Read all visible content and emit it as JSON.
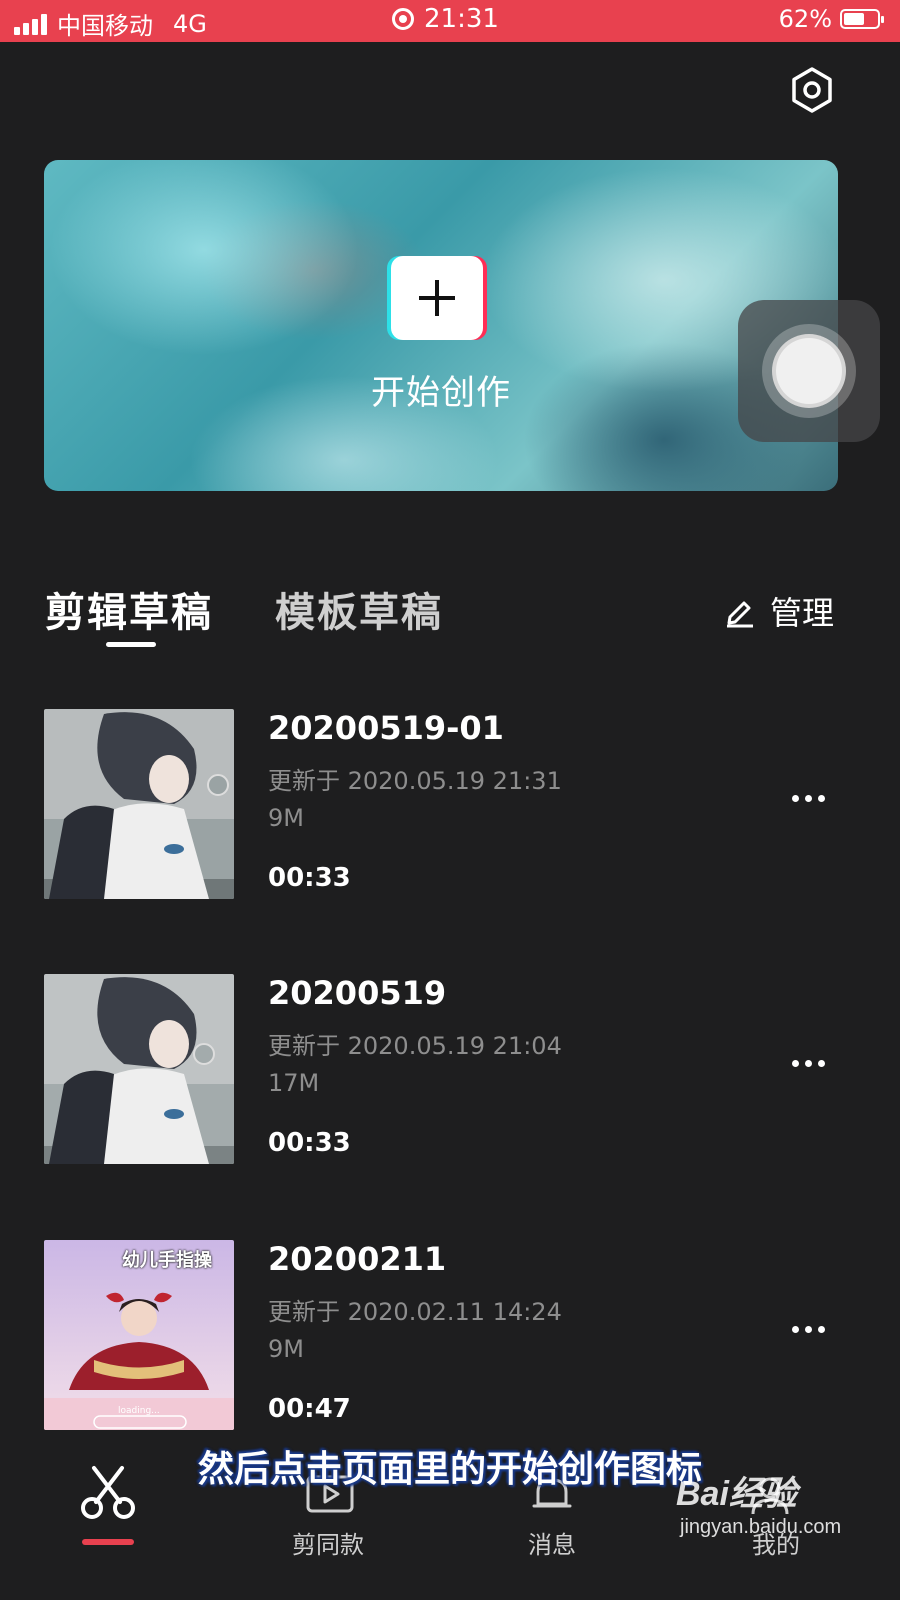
{
  "status_bar": {
    "carrier": "中国移动",
    "network": "4G",
    "time": "21:31",
    "battery_percent": "62%",
    "battery_level": 0.62
  },
  "banner": {
    "label": "开始创作"
  },
  "tabs": {
    "edit_drafts": "剪辑草稿",
    "template_drafts": "模板草稿",
    "manage": "管理"
  },
  "drafts": [
    {
      "title": "20200519-01",
      "updated": "更新于 2020.05.19 21:31",
      "size": "9M",
      "duration": "00:33"
    },
    {
      "title": "20200519",
      "updated": "更新于 2020.05.19 21:04",
      "size": "17M",
      "duration": "00:33"
    },
    {
      "title": "20200211",
      "updated": "更新于 2020.02.11 14:24",
      "size": "9M",
      "duration": "00:47",
      "thumb_text": "幼儿手指操",
      "thumb_sub": "loading..."
    }
  ],
  "bottom_nav": {
    "items": [
      "剪同款",
      "消息",
      "我的"
    ]
  },
  "overlay": {
    "subtitle": "然后点击页面里的开始创作图标",
    "watermark_logo": "Bai经验",
    "watermark_site": "jingyan.baidu.com"
  },
  "colors": {
    "accent": "#e8414f",
    "background": "#1e1e1f",
    "secondary_text": "#8e8e8e"
  }
}
